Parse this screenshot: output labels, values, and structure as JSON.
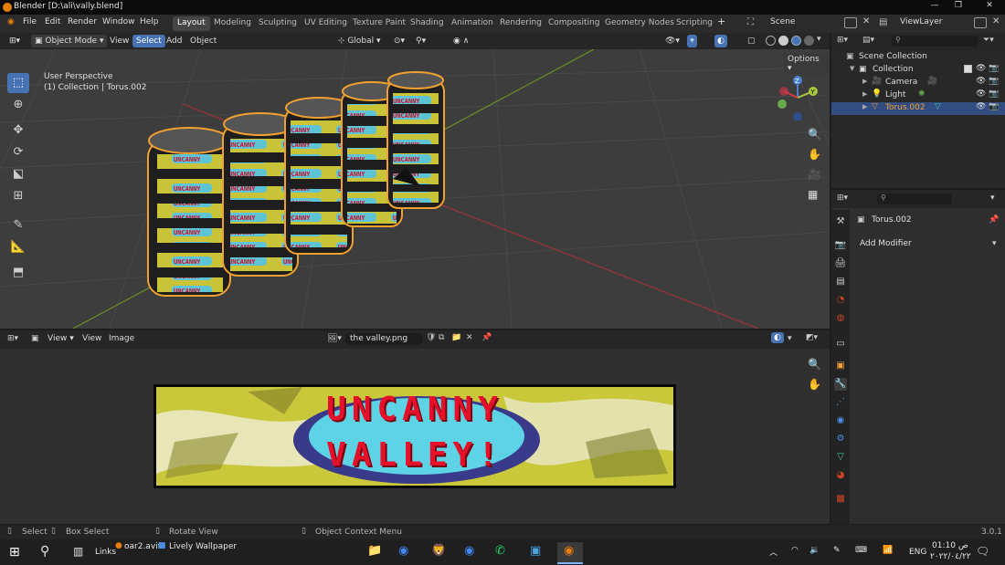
{
  "window": {
    "title": "Blender [D:\\ali\\vally.blend]"
  },
  "menu": [
    "File",
    "Edit",
    "Render",
    "Window",
    "Help"
  ],
  "workspaces": [
    "Layout",
    "Modeling",
    "Sculpting",
    "UV Editing",
    "Texture Paint",
    "Shading",
    "Animation",
    "Rendering",
    "Compositing",
    "Geometry Nodes",
    "Scripting"
  ],
  "active_workspace": "Layout",
  "scene": "Scene",
  "view_layer": "ViewLayer",
  "viewport_header": {
    "mode": "Object Mode",
    "view": "View",
    "select": "Select",
    "add": "Add",
    "object": "Object",
    "orientation": "Global",
    "options": "Options"
  },
  "viewport_info": {
    "line1": "User Perspective",
    "line2": "(1) Collection | Torus.002"
  },
  "outliner": {
    "scene_collection": "Scene Collection",
    "items": [
      {
        "label": "Collection",
        "icon": "collection-icon"
      },
      {
        "label": "Camera",
        "icon": "camera-icon"
      },
      {
        "label": "Light",
        "icon": "light-icon"
      },
      {
        "label": "Torus.002",
        "icon": "mesh-icon"
      }
    ]
  },
  "properties": {
    "object_name": "Torus.002",
    "add_modifier": "Add Modifier"
  },
  "image_editor": {
    "view1": "View",
    "view2": "View",
    "image": "Image",
    "filename": "the valley.png"
  },
  "banner": {
    "line1": "UNCANNY",
    "line2": "VALLEY!"
  },
  "label_texture": {
    "line1": "UNCANNY",
    "line2": "VALLEY"
  },
  "status": {
    "select": "Select",
    "box_select": "Box Select",
    "rotate": "Rotate View",
    "context": "Object Context Menu",
    "version": "3.0.1"
  },
  "taskbar": {
    "links": "Links",
    "app1": "oar2.avif",
    "app2": "Lively Wallpaper",
    "lang": "ENG",
    "time": "01:10 ص",
    "date": "٢٠٢٢/٠٤/٢٢"
  },
  "colors": {
    "accent": "#4772b3",
    "selection_orange": "#f0a030",
    "banner_red": "#e5112a",
    "banner_blue": "#5fd3e6",
    "banner_yellow": "#d8d641"
  }
}
